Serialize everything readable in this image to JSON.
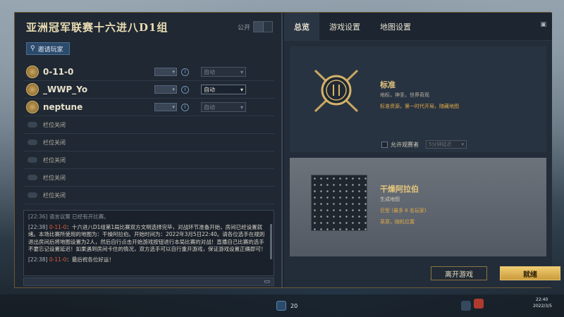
{
  "lobby": {
    "title": "亚洲冠军联赛十六进八D1组",
    "public_label": "公开",
    "invite_label": "邀请玩家"
  },
  "players": [
    {
      "name": "0-11-0",
      "team": "自动"
    },
    {
      "name": "_WWP_Yo",
      "team": "自动"
    },
    {
      "name": "neptune",
      "team": "自动"
    }
  ],
  "slots": [
    {
      "label": "栏位关闭"
    },
    {
      "label": "栏位关闭"
    },
    {
      "label": "栏位关闭"
    },
    {
      "label": "栏位关闭"
    },
    {
      "label": "栏位关闭"
    }
  ],
  "chat": {
    "prev_line": "[22:36] 语言议案 已经有开比赛。",
    "m1_ts": "[22:38]",
    "m1_name": "0-11-0",
    "m1_text": "：十六进八D1组第1局比赛双方文明选择完毕，对战环节准备开始，房间已经设置就绪。本场比赛所使用的地图为：干燥阿拉伯。开始时间为：2022年3月5日22:40。请各位选手在规则退出房间后将地图设置为2人，然后自行点击开始游戏按钮进行本局比赛的对战！直播自己比赛的选手不要忘记设置延迟！如果遇到房间卡住的情况，双方选手可以自行重开游戏，保证游戏设置正确即可！",
    "m2_ts": "[22:38]",
    "m2_name": "0-11-0",
    "m2_text": "：最后祝各位好运！"
  },
  "tabs": [
    {
      "label": "总览"
    },
    {
      "label": "游戏设置"
    },
    {
      "label": "地图设置"
    }
  ],
  "overview": {
    "ruleset_name": "标准",
    "ruleset_sub": "地标，神圣，世界奇观",
    "ruleset_sub2": "标准资源，第一时代开局，随藏地图",
    "spectator_label": "允许观赛者",
    "spectator_value": "5分钟延迟",
    "map_name": "干燥阿拉伯",
    "map_sub": "生成地图",
    "map_sub2": "巨型 (最多 8 名玩家)",
    "map_sub3": "草原，随机位置"
  },
  "buttons": {
    "leave": "离开游戏",
    "ready": "就绪"
  },
  "taskbar": {
    "count": "20",
    "time": "22:40",
    "date": "2022/3/5"
  },
  "colors": {
    "accent_gold": "#e4c67c",
    "chat_name": "#e05b3a",
    "ready_button": "#e6c470"
  }
}
